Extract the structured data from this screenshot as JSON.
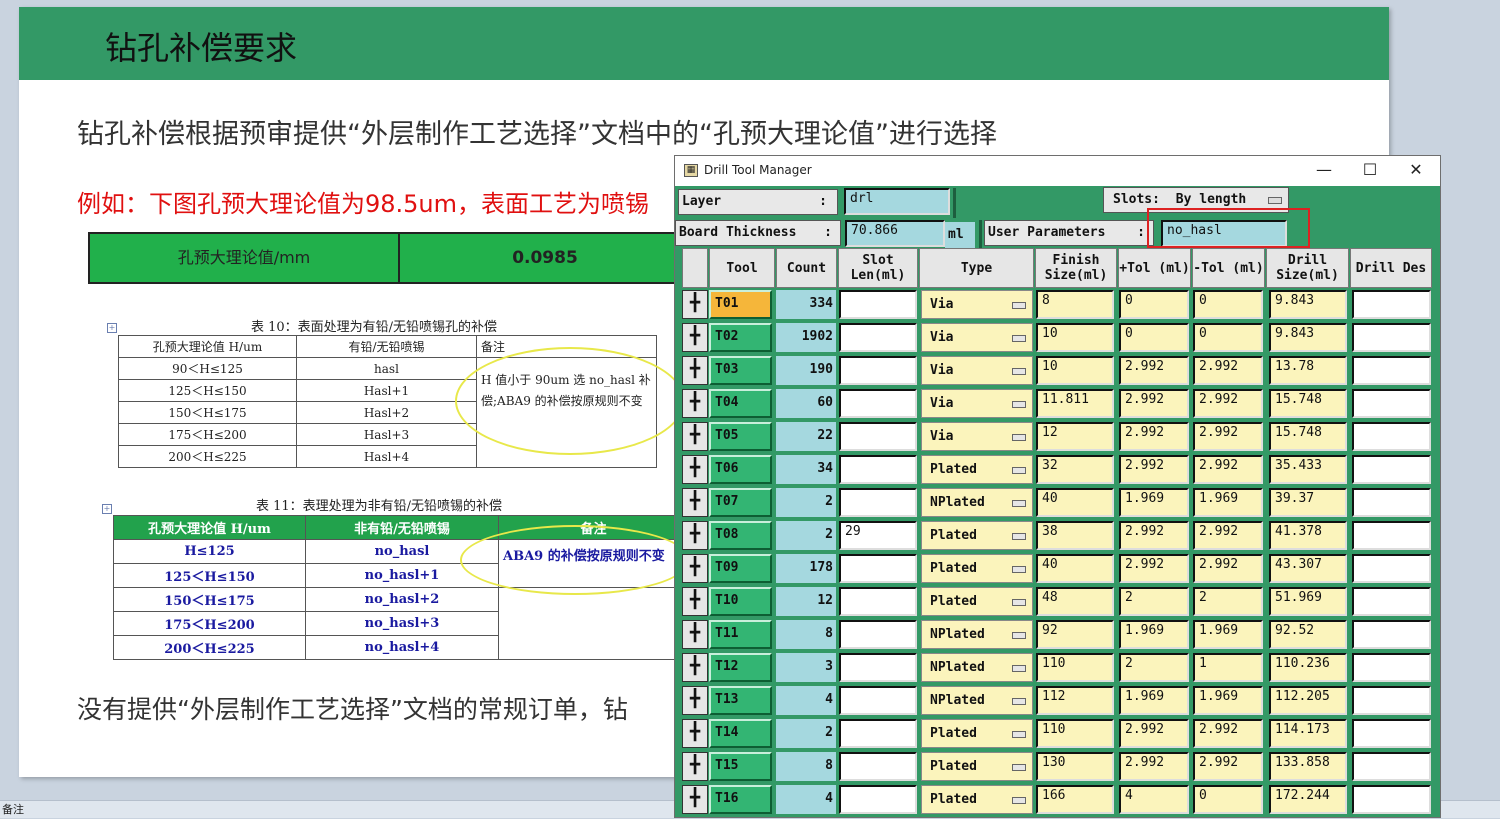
{
  "slide": {
    "title": "钻孔补偿要求",
    "paragraph1": "钻孔补偿根据预审提供“外层制作工艺选择”文档中的“孔预大理论值”进行选择",
    "paragraph2": "例如：下图孔预大理论值为98.5um，表面工艺为喷锡",
    "paragraph3": "没有提供“外层制作工艺选择”文档的常规订单，钻",
    "greenbar": {
      "label": "孔预大理论值/mm",
      "value": "0.0985"
    },
    "table10": {
      "caption": "表 10：表面处理为有铅/无铅喷锡孔的补偿",
      "headers": [
        "孔预大理论值 H/um",
        "有铅/无铅喷锡",
        "备注"
      ],
      "rows": [
        [
          "90＜H≤125",
          "hasl"
        ],
        [
          "125＜H≤150",
          "Hasl+1"
        ],
        [
          "150＜H≤175",
          "Hasl+2"
        ],
        [
          "175＜H≤200",
          "Hasl+3"
        ],
        [
          "200＜H≤225",
          "Hasl+4"
        ]
      ],
      "note": "H 值小于 90um 选 no_hasl 补偿;ABA9 的补偿按原规则不变"
    },
    "table11": {
      "caption": "表 11：表理处理为非有铅/无铅喷锡的补偿",
      "headers": [
        "孔预大理论值 H/um",
        "非有铅/无铅喷锡",
        "备注"
      ],
      "rows": [
        [
          "H≤125",
          "no_hasl"
        ],
        [
          "125＜H≤150",
          "no_hasl+1"
        ],
        [
          "150＜H≤175",
          "no_hasl+2"
        ],
        [
          "175＜H≤200",
          "no_hasl+3"
        ],
        [
          "200＜H≤225",
          "no_hasl+4"
        ]
      ],
      "note": "ABA9 的补偿按原规则不变"
    },
    "status_text": "备注"
  },
  "dialog": {
    "title": "Drill Tool Manager",
    "layer_label": "Layer",
    "layer_value": "drl",
    "slots_label": "Slots:",
    "slots_value": "By length",
    "board_thickness_label": "Board Thickness",
    "board_thickness_value": "70.866",
    "board_thickness_unit": "ml",
    "user_params_label": "User Parameters",
    "user_params_value": "no_hasl",
    "columns": [
      "Tool",
      "Count",
      "Slot Len(ml)",
      "Type",
      "Finish Size(ml)",
      "+Tol (ml)",
      "-Tol (ml)",
      "Drill Size(ml)",
      "Drill Des"
    ],
    "tools": [
      {
        "tool": "T01",
        "count": "334",
        "slot": "",
        "type": "Via",
        "finish": "8",
        "ptol": "0",
        "mtol": "0",
        "drill": "9.843"
      },
      {
        "tool": "T02",
        "count": "1902",
        "slot": "",
        "type": "Via",
        "finish": "10",
        "ptol": "0",
        "mtol": "0",
        "drill": "9.843"
      },
      {
        "tool": "T03",
        "count": "190",
        "slot": "",
        "type": "Via",
        "finish": "10",
        "ptol": "2.992",
        "mtol": "2.992",
        "drill": "13.78"
      },
      {
        "tool": "T04",
        "count": "60",
        "slot": "",
        "type": "Via",
        "finish": "11.811",
        "ptol": "2.992",
        "mtol": "2.992",
        "drill": "15.748"
      },
      {
        "tool": "T05",
        "count": "22",
        "slot": "",
        "type": "Via",
        "finish": "12",
        "ptol": "2.992",
        "mtol": "2.992",
        "drill": "15.748"
      },
      {
        "tool": "T06",
        "count": "34",
        "slot": "",
        "type": "Plated",
        "finish": "32",
        "ptol": "2.992",
        "mtol": "2.992",
        "drill": "35.433"
      },
      {
        "tool": "T07",
        "count": "2",
        "slot": "",
        "type": "NPlated",
        "finish": "40",
        "ptol": "1.969",
        "mtol": "1.969",
        "drill": "39.37"
      },
      {
        "tool": "T08",
        "count": "2",
        "slot": "29",
        "type": "Plated",
        "finish": "38",
        "ptol": "2.992",
        "mtol": "2.992",
        "drill": "41.378"
      },
      {
        "tool": "T09",
        "count": "178",
        "slot": "",
        "type": "Plated",
        "finish": "40",
        "ptol": "2.992",
        "mtol": "2.992",
        "drill": "43.307"
      },
      {
        "tool": "T10",
        "count": "12",
        "slot": "",
        "type": "Plated",
        "finish": "48",
        "ptol": "2",
        "mtol": "2",
        "drill": "51.969"
      },
      {
        "tool": "T11",
        "count": "8",
        "slot": "",
        "type": "NPlated",
        "finish": "92",
        "ptol": "1.969",
        "mtol": "1.969",
        "drill": "92.52"
      },
      {
        "tool": "T12",
        "count": "3",
        "slot": "",
        "type": "NPlated",
        "finish": "110",
        "ptol": "2",
        "mtol": "1",
        "drill": "110.236"
      },
      {
        "tool": "T13",
        "count": "4",
        "slot": "",
        "type": "NPlated",
        "finish": "112",
        "ptol": "1.969",
        "mtol": "1.969",
        "drill": "112.205"
      },
      {
        "tool": "T14",
        "count": "2",
        "slot": "",
        "type": "Plated",
        "finish": "110",
        "ptol": "2.992",
        "mtol": "2.992",
        "drill": "114.173"
      },
      {
        "tool": "T15",
        "count": "8",
        "slot": "",
        "type": "Plated",
        "finish": "130",
        "ptol": "2.992",
        "mtol": "2.992",
        "drill": "133.858"
      },
      {
        "tool": "T16",
        "count": "4",
        "slot": "",
        "type": "Plated",
        "finish": "166",
        "ptol": "4",
        "mtol": "0",
        "drill": "172.244"
      }
    ]
  },
  "colors": {
    "slide_header": "#339966",
    "dialog_bg": "#339966",
    "highlight_red": "#dd2222",
    "annotation_yellow": "#e8e84a"
  }
}
